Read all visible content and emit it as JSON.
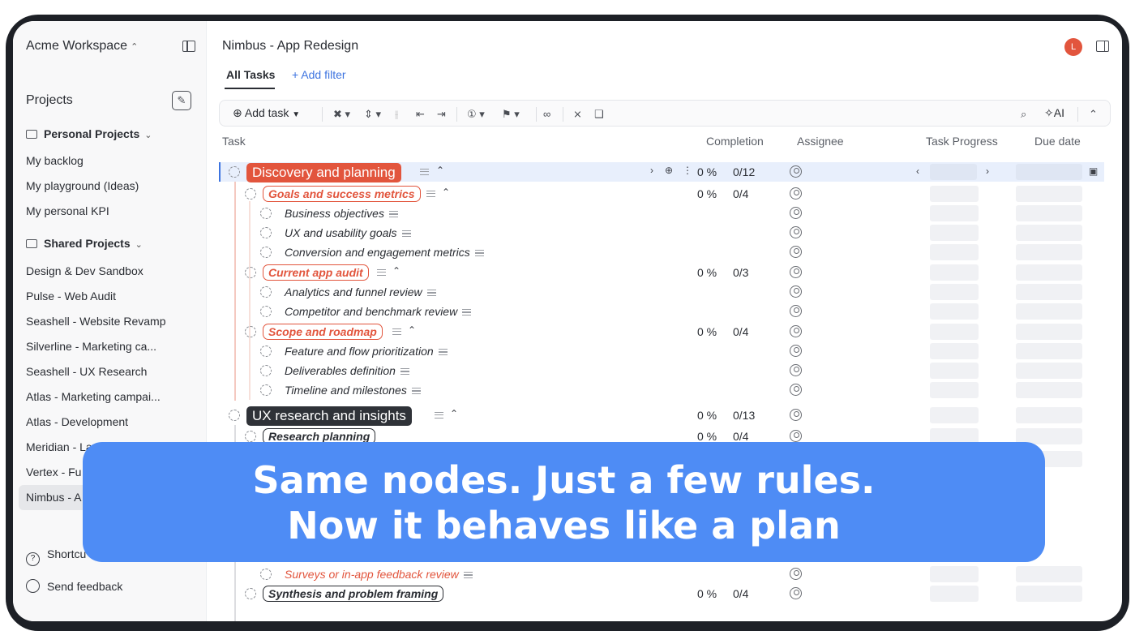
{
  "sidebar": {
    "workspace": "Acme Workspace",
    "projects_heading": "Projects",
    "groups": [
      {
        "label": "Personal Projects",
        "items": [
          "My backlog",
          "My playground (Ideas)",
          "My personal KPI"
        ]
      },
      {
        "label": "Shared Projects",
        "items": [
          "Design & Dev Sandbox",
          "Pulse - Web Audit",
          "Seashell - Website Revamp",
          "Silverline - Marketing ca...",
          "Seashell - UX Research",
          "Atlas - Marketing campai...",
          "Atlas - Development",
          "Meridian - La",
          "Vertex - Fu",
          "Nimbus - A"
        ]
      }
    ],
    "footer": [
      "Shortcu",
      "Send feedback"
    ]
  },
  "header": {
    "title": "Nimbus - App Redesign",
    "avatar_initial": "L",
    "tab_active": "All Tasks",
    "add_filter": "+ Add filter"
  },
  "toolbar": {
    "add_task": "Add task",
    "ai": "AI"
  },
  "columns": {
    "task": "Task",
    "completion": "Completion",
    "assignee": "Assignee",
    "task_progress": "Task Progress",
    "due_date": "Due date"
  },
  "rows": [
    {
      "level": 0,
      "label": "Discovery and planning",
      "pct": "0 %",
      "frac": "0/12",
      "color": "#e2553d"
    },
    {
      "level": 1,
      "label": "Goals and success metrics",
      "pct": "0 %",
      "frac": "0/4"
    },
    {
      "level": 2,
      "label": "Business objectives"
    },
    {
      "level": 2,
      "label": "UX and usability goals"
    },
    {
      "level": 2,
      "label": "Conversion and engagement metrics"
    },
    {
      "level": 1,
      "label": "Current app audit",
      "pct": "0 %",
      "frac": "0/3"
    },
    {
      "level": 2,
      "label": "Analytics and funnel review"
    },
    {
      "level": 2,
      "label": "Competitor and benchmark review"
    },
    {
      "level": 1,
      "label": "Scope and roadmap",
      "pct": "0 %",
      "frac": "0/4"
    },
    {
      "level": 2,
      "label": "Feature and flow prioritization"
    },
    {
      "level": 2,
      "label": "Deliverables definition"
    },
    {
      "level": 2,
      "label": "Timeline and milestones"
    },
    {
      "level": 0,
      "label": "UX research and insights",
      "pct": "0 %",
      "frac": "0/13",
      "color": "#2f3238"
    },
    {
      "level": 1,
      "label": "Research planning",
      "pct": "0 %",
      "frac": "0/4"
    },
    {
      "level": 2,
      "label": "Surveys or in-app feedback review"
    },
    {
      "level": 1,
      "label": "Synthesis and problem framing",
      "pct": "0 %",
      "frac": "0/4"
    }
  ],
  "overlay": {
    "line1": "Same nodes. Just a few rules.",
    "line2": "Now it behaves like a plan"
  },
  "colors": {
    "accent": "#3d74e0",
    "red": "#e2553d",
    "overlay": "#4e8cf5"
  }
}
